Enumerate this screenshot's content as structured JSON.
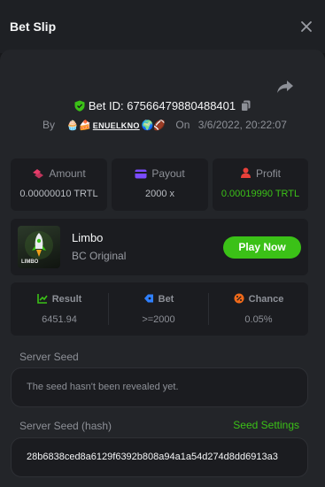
{
  "header": {
    "title": "Bet Slip"
  },
  "bet": {
    "id_label": "Bet ID: 6756647988048840​1",
    "by_label": "By",
    "user": "ENUELKNO",
    "user_emoji_prefix": "🧁🍰",
    "user_emoji_suffix": "🌍🏈",
    "on_label": "On",
    "date": "3/6/2022, 20:22:07"
  },
  "stats": [
    {
      "label": "Amount",
      "value": "0.00000010 TRTL"
    },
    {
      "label": "Payout",
      "value": "2000 x"
    },
    {
      "label": "Profit",
      "value": "0.00019990 TRTL"
    }
  ],
  "game": {
    "thumb_label": "LIMBO",
    "name": "Limbo",
    "provider": "BC Original",
    "play_label": "Play Now"
  },
  "results": [
    {
      "label": "Result",
      "value": "6451.94"
    },
    {
      "label": "Bet",
      "value": ">=2000"
    },
    {
      "label": "Chance",
      "value": "0.05%"
    }
  ],
  "seed": {
    "server_label": "Server Seed",
    "server_value": "The seed hasn't been revealed yet.",
    "hash_label": "Server Seed (hash)",
    "settings_label": "Seed Settings",
    "hash_value": "28b6838ced8a6129f6392b808a94a1a54d274d8dd6913a3"
  },
  "colors": {
    "accent_green": "#3bc117",
    "amount_icon": "#e83c6a",
    "payout_icon": "#7b4bff",
    "profit_icon": "#e8403a",
    "chance_icon": "#f06a1a",
    "bet_icon": "#2f80ff"
  }
}
